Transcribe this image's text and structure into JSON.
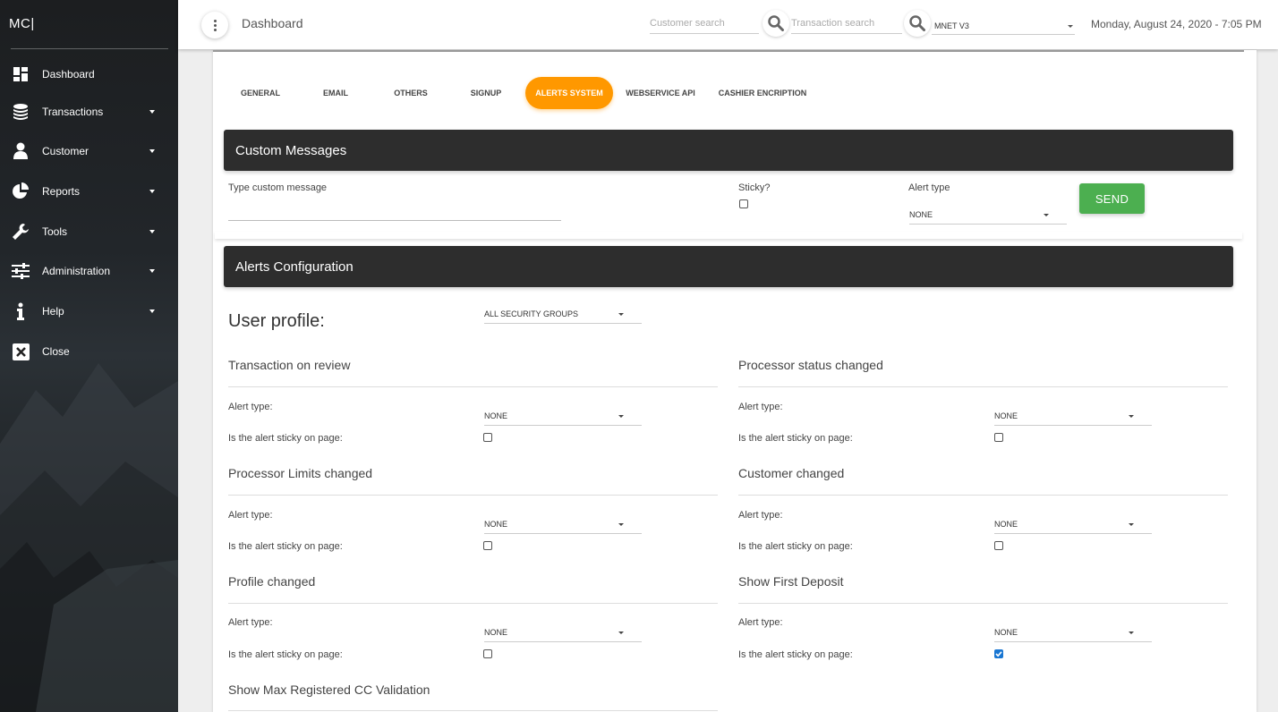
{
  "app": {
    "logo": "MC|"
  },
  "sidebar": {
    "items": [
      {
        "label": "Dashboard",
        "icon": "dashboard-icon",
        "has_caret": false
      },
      {
        "label": "Transactions",
        "icon": "coins-icon",
        "has_caret": true
      },
      {
        "label": "Customer",
        "icon": "user-icon",
        "has_caret": true
      },
      {
        "label": "Reports",
        "icon": "pie-chart-icon",
        "has_caret": true
      },
      {
        "label": "Tools",
        "icon": "wrench-icon",
        "has_caret": true
      },
      {
        "label": "Administration",
        "icon": "sliders-icon",
        "has_caret": true
      },
      {
        "label": "Help",
        "icon": "info-icon",
        "has_caret": true
      },
      {
        "label": "Close",
        "icon": "close-box-icon",
        "has_caret": false
      }
    ]
  },
  "header": {
    "title": "Dashboard",
    "customer_search_placeholder": "Customer search",
    "transaction_search_placeholder": "Transaction search",
    "site_select": "MNET V3",
    "datetime": "Monday, August 24, 2020 - 7:05 PM"
  },
  "tabs": [
    {
      "label": "GENERAL",
      "active": false
    },
    {
      "label": "EMAIL",
      "active": false
    },
    {
      "label": "OTHERS",
      "active": false
    },
    {
      "label": "SIGNUP",
      "active": false
    },
    {
      "label": "ALERTS SYSTEM",
      "active": true
    },
    {
      "label": "WEBSERVICE API",
      "active": false
    },
    {
      "label": "CASHIER ENCRIPTION",
      "active": false
    }
  ],
  "custom_messages": {
    "title": "Custom Messages",
    "message_label": "Type custom message",
    "message_value": "",
    "sticky_label": "Sticky?",
    "sticky_checked": false,
    "alert_type_label": "Alert type",
    "alert_type_value": "NONE",
    "send_label": "SEND"
  },
  "alerts_config": {
    "title": "Alerts Configuration",
    "user_profile_label": "User profile:",
    "user_profile_value": "ALL SECURITY GROUPS",
    "alert_type_label": "Alert type:",
    "sticky_label": "Is the alert sticky on page:",
    "sections": [
      {
        "title": "Transaction on review",
        "alert_type": "NONE",
        "sticky": false
      },
      {
        "title": "Processor status changed",
        "alert_type": "NONE",
        "sticky": false
      },
      {
        "title": "Processor Limits changed",
        "alert_type": "NONE",
        "sticky": false
      },
      {
        "title": "Customer changed",
        "alert_type": "NONE",
        "sticky": false
      },
      {
        "title": "Profile changed",
        "alert_type": "NONE",
        "sticky": false
      },
      {
        "title": "Show First Deposit",
        "alert_type": "NONE",
        "sticky": true
      },
      {
        "title": "Show Max Registered CC Validation",
        "alert_type": "",
        "sticky": false
      }
    ]
  },
  "colors": {
    "accent": "#ff9800",
    "send": "#4caf50",
    "header_dark": "#2d2d2d",
    "checkbox_on": "#1976d2"
  }
}
